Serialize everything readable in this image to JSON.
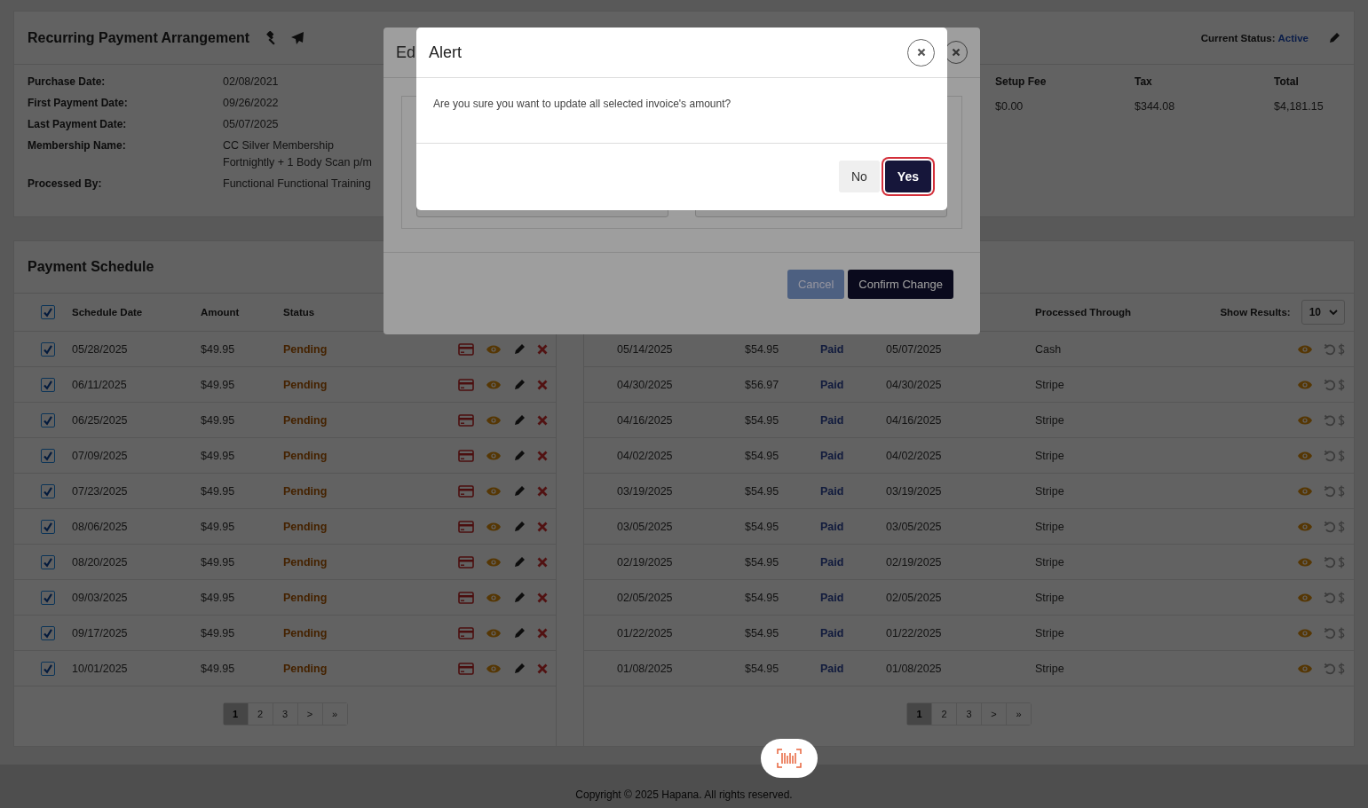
{
  "arrangement": {
    "title": "Recurring Payment Arrangement",
    "status_label": "Current Status:",
    "status_value": "Active",
    "details": [
      {
        "label": "Purchase Date:",
        "lines": [
          "02/08/2021"
        ]
      },
      {
        "label": "First Payment Date:",
        "lines": [
          "09/26/2022"
        ]
      },
      {
        "label": "Last Payment Date:",
        "lines": [
          "05/07/2025"
        ]
      },
      {
        "label": "Membership Name:",
        "lines": [
          "CC Silver Membership",
          "Fortnightly + 1 Body Scan p/m"
        ]
      },
      {
        "label": "Processed By:",
        "lines": [
          "Functional Functional Training"
        ]
      }
    ],
    "fees": [
      {
        "label": "Setup Fee",
        "value": "$0.00"
      },
      {
        "label": "Tax",
        "value": "$344.08"
      },
      {
        "label": "Total",
        "value": "$4,181.15"
      }
    ]
  },
  "schedule": {
    "title": "Payment Schedule",
    "select_all_checked": true,
    "columns": [
      "Schedule Date",
      "Amount",
      "Status"
    ],
    "rows": [
      {
        "checked": true,
        "date": "05/28/2025",
        "amount": "$49.95",
        "status": "Pending"
      },
      {
        "checked": true,
        "date": "06/11/2025",
        "amount": "$49.95",
        "status": "Pending"
      },
      {
        "checked": true,
        "date": "06/25/2025",
        "amount": "$49.95",
        "status": "Pending"
      },
      {
        "checked": true,
        "date": "07/09/2025",
        "amount": "$49.95",
        "status": "Pending"
      },
      {
        "checked": true,
        "date": "07/23/2025",
        "amount": "$49.95",
        "status": "Pending"
      },
      {
        "checked": true,
        "date": "08/06/2025",
        "amount": "$49.95",
        "status": "Pending"
      },
      {
        "checked": true,
        "date": "08/20/2025",
        "amount": "$49.95",
        "status": "Pending"
      },
      {
        "checked": true,
        "date": "09/03/2025",
        "amount": "$49.95",
        "status": "Pending"
      },
      {
        "checked": true,
        "date": "09/17/2025",
        "amount": "$49.95",
        "status": "Pending"
      },
      {
        "checked": true,
        "date": "10/01/2025",
        "amount": "$49.95",
        "status": "Pending"
      }
    ],
    "pagination": [
      {
        "label": "1",
        "selected": true
      },
      {
        "label": "2",
        "selected": false
      },
      {
        "label": "3",
        "selected": false
      },
      {
        "label": ">",
        "selected": false
      },
      {
        "label": "»",
        "selected": false
      }
    ]
  },
  "history": {
    "columns": [
      "Processed Through"
    ],
    "show_results_label": "Show Results:",
    "show_results_value": "10",
    "rows": [
      {
        "due_date": "05/14/2025",
        "amount": "$54.95",
        "status": "Paid",
        "paid_date": "05/07/2025",
        "processed_through": "Cash"
      },
      {
        "due_date": "04/30/2025",
        "amount": "$56.97",
        "status": "Paid",
        "paid_date": "04/30/2025",
        "processed_through": "Stripe"
      },
      {
        "due_date": "04/16/2025",
        "amount": "$54.95",
        "status": "Paid",
        "paid_date": "04/16/2025",
        "processed_through": "Stripe"
      },
      {
        "due_date": "04/02/2025",
        "amount": "$54.95",
        "status": "Paid",
        "paid_date": "04/02/2025",
        "processed_through": "Stripe"
      },
      {
        "due_date": "03/19/2025",
        "amount": "$54.95",
        "status": "Paid",
        "paid_date": "03/19/2025",
        "processed_through": "Stripe"
      },
      {
        "due_date": "03/05/2025",
        "amount": "$54.95",
        "status": "Paid",
        "paid_date": "03/05/2025",
        "processed_through": "Stripe"
      },
      {
        "due_date": "02/19/2025",
        "amount": "$54.95",
        "status": "Paid",
        "paid_date": "02/19/2025",
        "processed_through": "Stripe"
      },
      {
        "due_date": "02/05/2025",
        "amount": "$54.95",
        "status": "Paid",
        "paid_date": "02/05/2025",
        "processed_through": "Stripe"
      },
      {
        "due_date": "01/22/2025",
        "amount": "$54.95",
        "status": "Paid",
        "paid_date": "01/22/2025",
        "processed_through": "Stripe"
      },
      {
        "due_date": "01/08/2025",
        "amount": "$54.95",
        "status": "Paid",
        "paid_date": "01/08/2025",
        "processed_through": "Stripe"
      }
    ],
    "pagination": [
      {
        "label": "1",
        "selected": true
      },
      {
        "label": "2",
        "selected": false
      },
      {
        "label": "3",
        "selected": false
      },
      {
        "label": ">",
        "selected": false
      },
      {
        "label": "»",
        "selected": false
      }
    ]
  },
  "edit_modal": {
    "title": "Ed",
    "buttons": [
      {
        "label": "Cancel",
        "kind": "secondary"
      },
      {
        "label": "Confirm Change",
        "kind": "primary"
      }
    ]
  },
  "alert": {
    "title": "Alert",
    "message": "Are you sure you want to update all selected invoice's amount?",
    "buttons": [
      {
        "label": "No",
        "kind": "secondary",
        "focused": false
      },
      {
        "label": "Yes",
        "kind": "primary",
        "focused": true
      }
    ]
  },
  "footer": {
    "copyright": "Copyright © 2025 Hapana. All rights reserved."
  }
}
